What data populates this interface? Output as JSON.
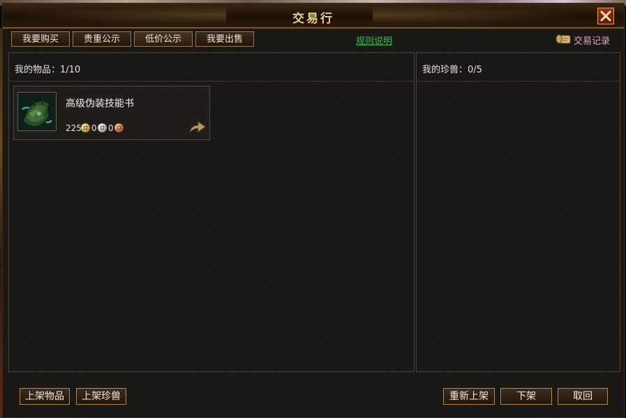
{
  "window": {
    "title": "交易行"
  },
  "tabs": [
    {
      "label": "我要购买"
    },
    {
      "label": "贵重公示"
    },
    {
      "label": "低价公示"
    },
    {
      "label": "我要出售"
    }
  ],
  "rules_link": "规则说明",
  "records_label": "交易记录",
  "left_panel": {
    "header": "我的物品：1/10",
    "items": [
      {
        "name": "高级伪装技能书",
        "gold": "225",
        "silver": "0",
        "copper": "0",
        "icon": "skill-book-icon"
      }
    ]
  },
  "right_panel": {
    "header": "我的珍兽：0/5"
  },
  "buttons": {
    "list_item": "上架物品",
    "list_pet": "上架珍兽",
    "relist": "重新上架",
    "delist": "下架",
    "cancel": "取回"
  },
  "colors": {
    "title": "#f0d080",
    "rules_link": "#38c048",
    "records": "#e8a0c8",
    "border": "#b08a48"
  }
}
